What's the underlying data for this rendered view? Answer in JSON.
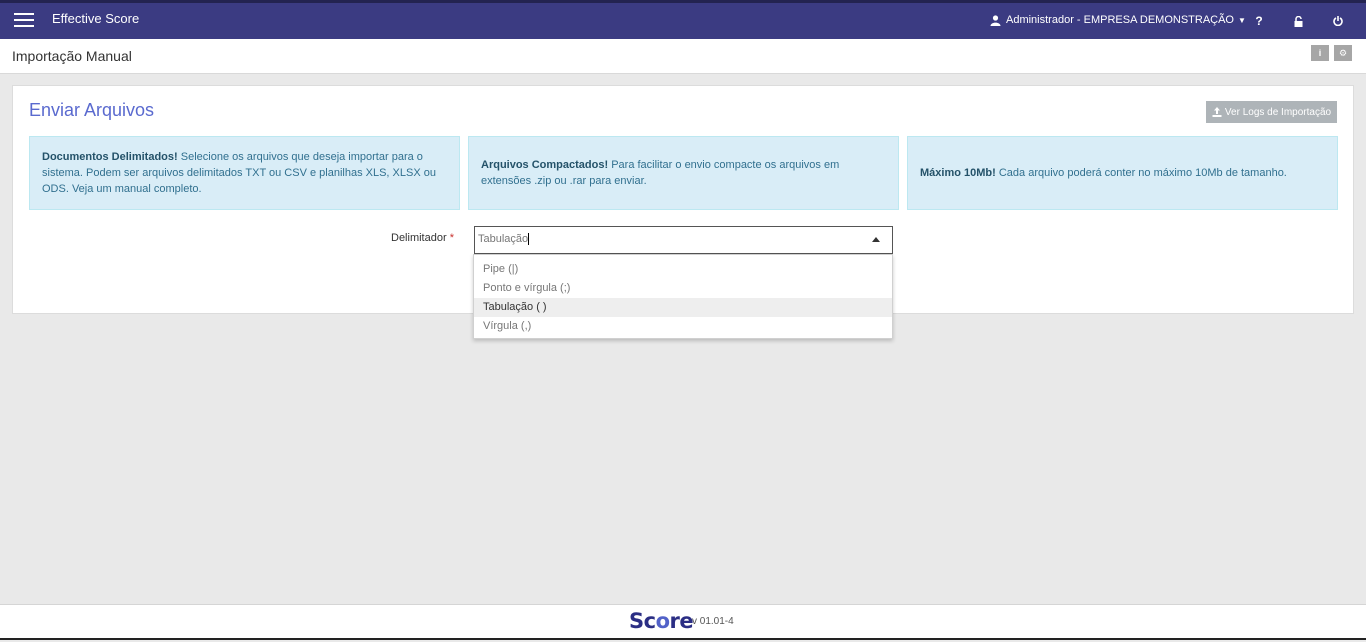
{
  "header": {
    "app_title": "Effective Score",
    "user_label": "Administrador - EMPRESA DEMONSTRAÇÃO",
    "help_glyph": "?",
    "icons": [
      "menu-icon",
      "user-icon",
      "help-icon",
      "lock-icon",
      "power-icon"
    ]
  },
  "titlebar": {
    "page_title": "Importação Manual",
    "info_glyph": "i",
    "settings_glyph": "⚙"
  },
  "panel": {
    "title": "Enviar Arquivos",
    "logs_button": "Ver Logs de Importação",
    "alerts": [
      {
        "bold": "Documentos Delimitados!",
        "text": "Selecione os arquivos que deseja importar para o sistema. Podem ser arquivos delimitados TXT ou CSV e planilhas XLS, XLSX ou ODS. Veja um manual completo."
      },
      {
        "bold": "Arquivos Compactados!",
        "text": "Para facilitar o envio compacte os arquivos em extensões .zip ou .rar para enviar."
      },
      {
        "bold": "Máximo 10Mb!",
        "text": "Cada arquivo poderá conter no máximo 10Mb de tamanho."
      }
    ],
    "delimiter": {
      "label": "Delimitador",
      "required_mark": "*",
      "value": "Tabulação",
      "options": [
        "Pipe (|)",
        "Ponto e vírgula (;)",
        "Tabulação ( )",
        "Vírgula (,)"
      ],
      "selected_index": 2
    }
  },
  "footer": {
    "logo_prefix": "Sc",
    "logo_o": "o",
    "logo_suffix": "re",
    "version": "v 01.01-4"
  },
  "colors": {
    "header_bg": "#3b3b82",
    "accent": "#5a6acf",
    "alert_bg": "#d9edf7",
    "logo": "#2b2e84"
  }
}
